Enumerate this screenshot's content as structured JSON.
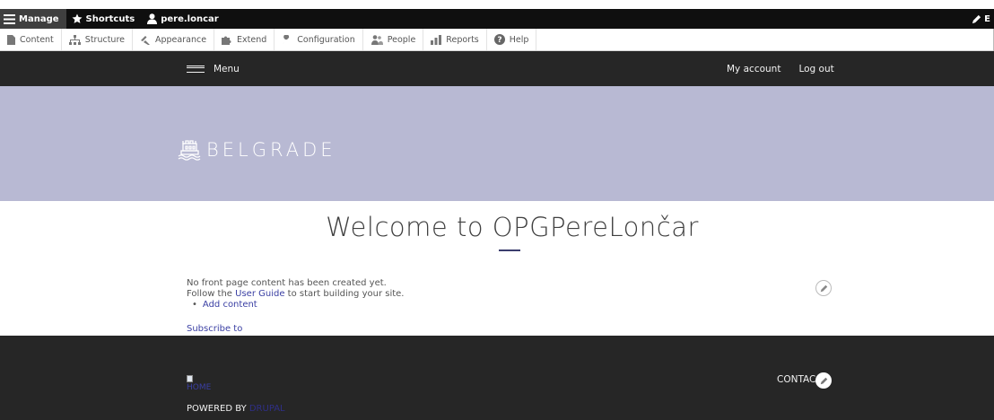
{
  "toolbar": {
    "manage": "Manage",
    "shortcuts": "Shortcuts",
    "user": "pere.loncar",
    "edit": "E"
  },
  "tray": {
    "items": [
      "Content",
      "Structure",
      "Appearance",
      "Extend",
      "Configuration",
      "People",
      "Reports",
      "Help"
    ]
  },
  "nav": {
    "menu": "Menu",
    "my_account": "My account",
    "log_out": "Log out"
  },
  "banner": {
    "site_name": "BELGRADE"
  },
  "main": {
    "title": "Welcome to OPGPereLončar",
    "no_content": "No front page content has been created yet.",
    "follow_prefix": "Follow the ",
    "user_guide": "User Guide",
    "follow_suffix": " to start building your site.",
    "add_content": "Add content",
    "subscribe": "Subscribe to"
  },
  "footer": {
    "home": "HOME",
    "powered_by": "POWERED BY ",
    "drupal": "DRUPAL",
    "contact": "CONTAC"
  },
  "colors": {
    "toolbar_bg": "#0f0f0f",
    "nav_bg": "#262626",
    "banner_bg": "#b8b9d3",
    "link": "#3a3fa3",
    "accent_rule": "#3b3d6e"
  }
}
